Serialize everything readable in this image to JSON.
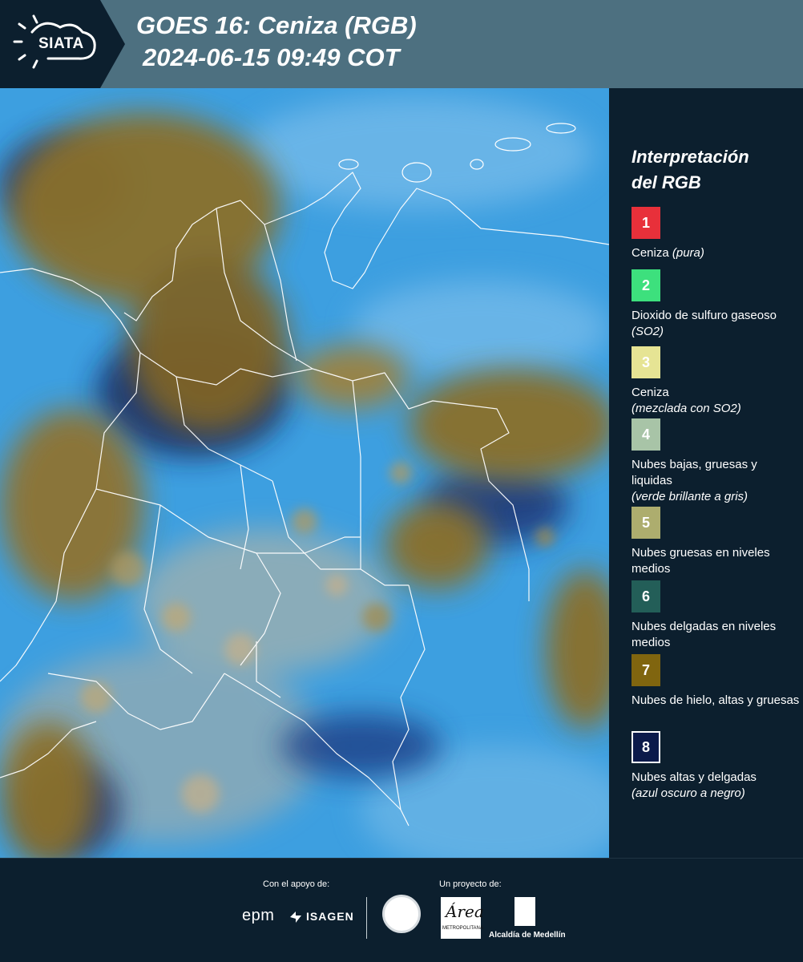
{
  "header": {
    "logo_text": "SIATA",
    "title_line1": "GOES 16: Ceniza (RGB)",
    "title_line2": "2024-06-15 09:49 COT"
  },
  "legend": {
    "title_line1": "Interpretación",
    "title_line2": "del RGB",
    "items": [
      {
        "number": "1",
        "color": "#e8303a",
        "text": "Ceniza",
        "note": "(pura)"
      },
      {
        "number": "2",
        "color": "#3de07d",
        "text": "Dioxido de sulfuro gaseoso",
        "note": "(SO2)"
      },
      {
        "number": "3",
        "color": "#e6e494",
        "text": "Ceniza",
        "note": "(mezclada con SO2)"
      },
      {
        "number": "4",
        "color": "#a8c4a7",
        "text": "Nubes bajas, gruesas y liquidas",
        "note": "(verde brillante a gris)"
      },
      {
        "number": "5",
        "color": "#adad6e",
        "text": "Nubes gruesas en niveles medios",
        "note": ""
      },
      {
        "number": "6",
        "color": "#235e58",
        "text": "Nubes delgadas en niveles medios",
        "note": ""
      },
      {
        "number": "7",
        "color": "#80650f",
        "text": "Nubes de hielo, altas y gruesas",
        "note": ""
      },
      {
        "number": "8",
        "color": "#0b1a4a",
        "text": "Nubes altas y delgadas",
        "note": "(azul oscuro a negro)"
      }
    ]
  },
  "footer": {
    "support_label": "Con el apoyo de:",
    "project_label": "Un proyecto de:",
    "epm": "epm",
    "isagen": "ISAGEN",
    "area_mark": "Área",
    "area_small": "METROPOLITANA",
    "alcaldia": "Alcaldía de Medellín"
  },
  "colors": {
    "header_bg": "#4d7080",
    "panel_bg": "#0c1f2e",
    "sky_blue": "#3da0e0",
    "cloud_ochre": "#8a6f2a"
  }
}
